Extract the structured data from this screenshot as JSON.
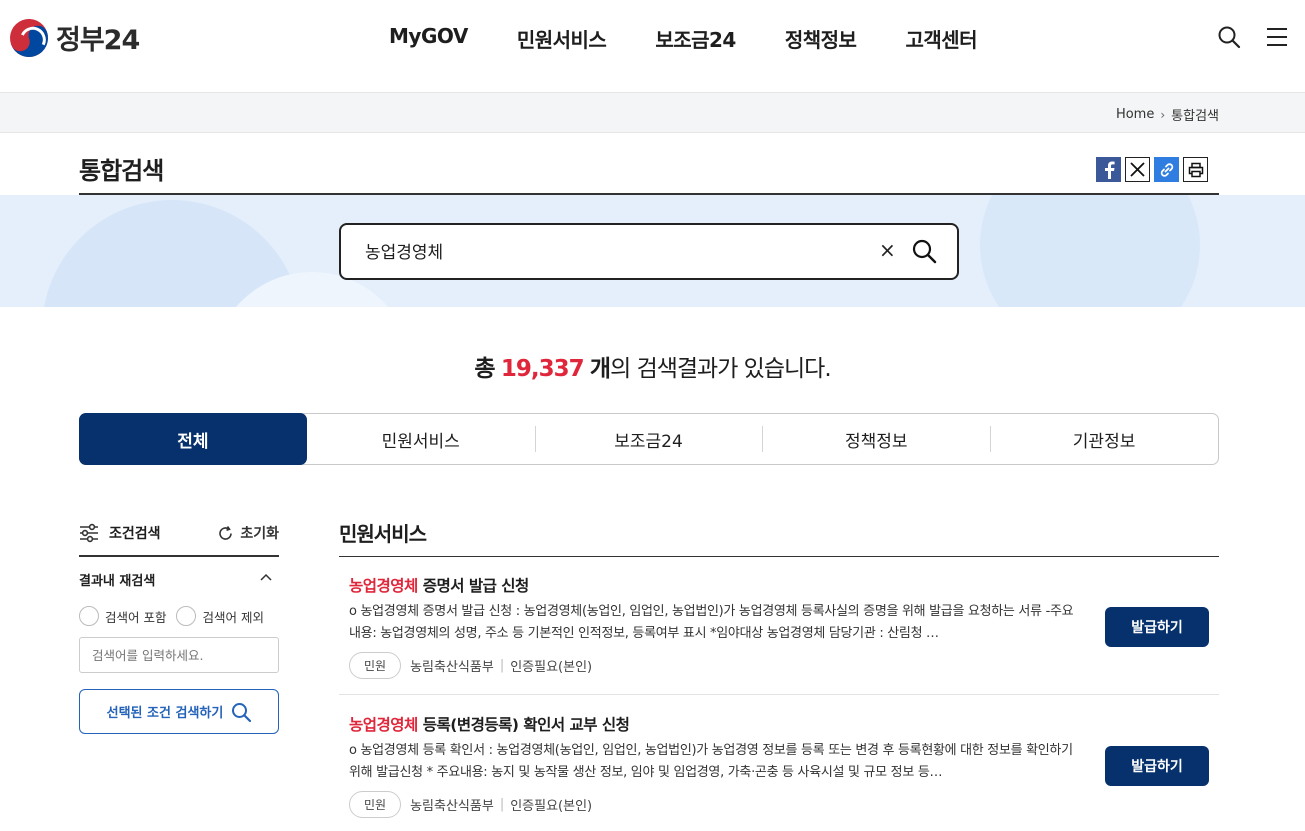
{
  "header": {
    "logo_text": "정부24",
    "nav": [
      "MyGOV",
      "민원서비스",
      "보조금24",
      "정책정보",
      "고객센터"
    ],
    "icons": [
      "search-icon",
      "menu-icon"
    ]
  },
  "breadcrumb": {
    "home": "Home",
    "current": "통합검색"
  },
  "page": {
    "title": "통합검색"
  },
  "share": [
    "facebook-icon",
    "x-icon",
    "link-icon",
    "print-icon"
  ],
  "search": {
    "value": "농업경영체",
    "clear_label": "×"
  },
  "result": {
    "prefix": "총",
    "count": "19,337",
    "unit": "개",
    "suffix": "의 검색결과가 있습니다."
  },
  "tabs": [
    {
      "label": "전체",
      "active": true
    },
    {
      "label": "민원서비스",
      "active": false
    },
    {
      "label": "보조금24",
      "active": false
    },
    {
      "label": "정책정보",
      "active": false
    },
    {
      "label": "기관정보",
      "active": false
    }
  ],
  "filter": {
    "title": "조건검색",
    "reset": "초기화",
    "research_title": "결과내 재검색",
    "include_label": "검색어 포함",
    "exclude_label": "검색어 제외",
    "input_placeholder": "검색어를 입력하세요.",
    "search_button": "선택된 조건 검색하기"
  },
  "section": {
    "title": "민원서비스"
  },
  "items": [
    {
      "title_highlight": "농업경영체",
      "title_rest": " 증명서 발급 신청",
      "desc": "o 농업경영체 증명서 발급 신청 : 농업경영체(농업인, 임업인, 농업법인)가 농업경영체 등록사실의 증명을 위해 발급을 요청하는 서류 -주요내용: 농업경영체의 성명, 주소 등 기본적인 인적정보, 등록여부 표시 *임야대상 농업경영체 담당기관 : 산림청 …",
      "badge": "민원",
      "agency": "농림축산식품부",
      "auth": "인증필요(본인)",
      "button": "발급하기"
    },
    {
      "title_highlight": "농업경영체",
      "title_rest": " 등록(변경등록) 확인서 교부 신청",
      "desc": "o 농업경영체 등록 확인서 : 농업경영체(농업인, 임업인, 농업법인)가 농업경영 정보를 등록 또는 변경 후 등록현황에 대한 정보를 확인하기 위해 발급신청 * 주요내용: 농지 및 농작물 생산 정보, 임야 및 임업경영, 가축·곤충 등 사육시설 및 규모 정보 등…",
      "badge": "민원",
      "agency": "농림축산식품부",
      "auth": "인증필요(본인)",
      "button": "발급하기"
    }
  ]
}
